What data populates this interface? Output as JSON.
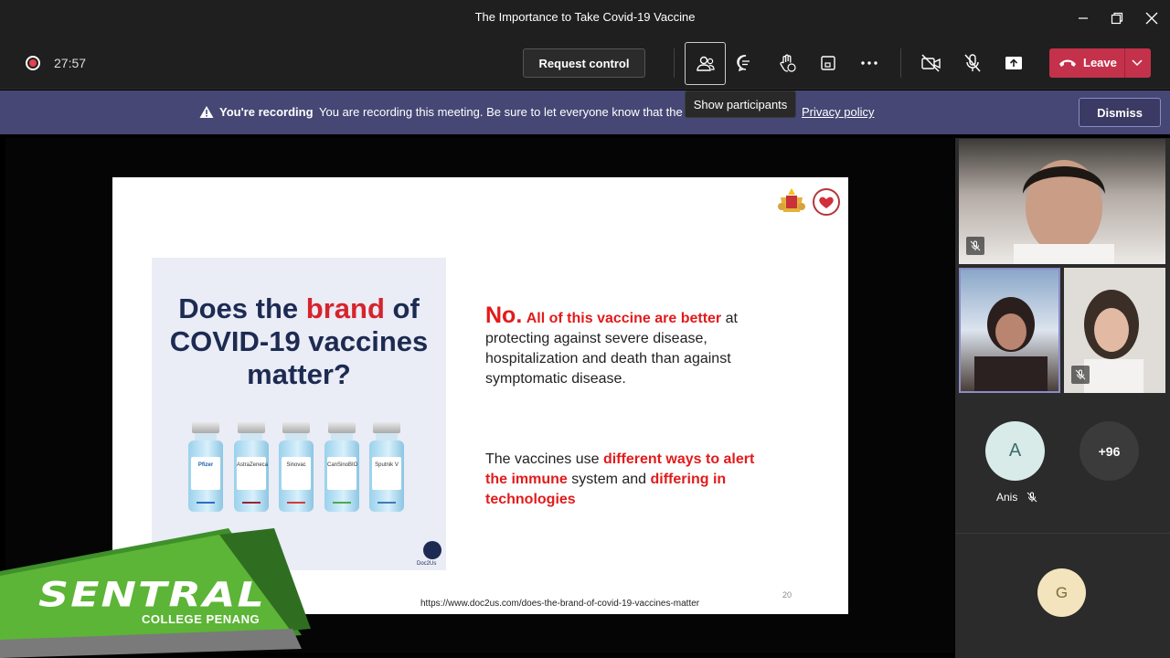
{
  "window": {
    "title": "The Importance to Take Covid-19 Vaccine"
  },
  "toolbar": {
    "timer": "27:57",
    "request_control": "Request control",
    "leave": "Leave",
    "tooltip": "Show participants"
  },
  "banner": {
    "strong": "You're recording",
    "message": "You are recording this meeting. Be sure to let everyone know that the",
    "link": "Privacy policy",
    "dismiss": "Dismiss"
  },
  "slide": {
    "poster": {
      "line1_a": "Does the ",
      "line1_b": "brand",
      "line1_c": " of",
      "line2": "COVID-19 vaccines",
      "line3": "matter?",
      "vials": [
        "Pfizer",
        "AstraZeneca",
        "Sinovac",
        "CanSinoBIO",
        "Sputnik V"
      ],
      "brand": "Doc2Us"
    },
    "p1_no": "No.",
    "p1_red": "All of this vaccine are better",
    "p1_rest_a": " at",
    "p1_rest_b": "protecting against severe disease, hospitalization and death than against symptomatic disease.",
    "p2_a": "The vaccines use ",
    "p2_red1": "different ways to alert the immune",
    "p2_b": " system and ",
    "p2_red2": "differing in technologies",
    "number": "20",
    "url": "https://www.doc2us.com/does-the-brand-of-covid-19-vaccines-matter"
  },
  "overlay": {
    "brand": "SENTRAL",
    "sub": "COLLEGE PENANG"
  },
  "participants": {
    "avatar_a": "A",
    "name_a": "Anis",
    "more": "+96",
    "avatar_g": "G"
  },
  "colors": {
    "accent": "#464775",
    "leave": "#c4314b",
    "slide_red": "#e21b1b"
  }
}
